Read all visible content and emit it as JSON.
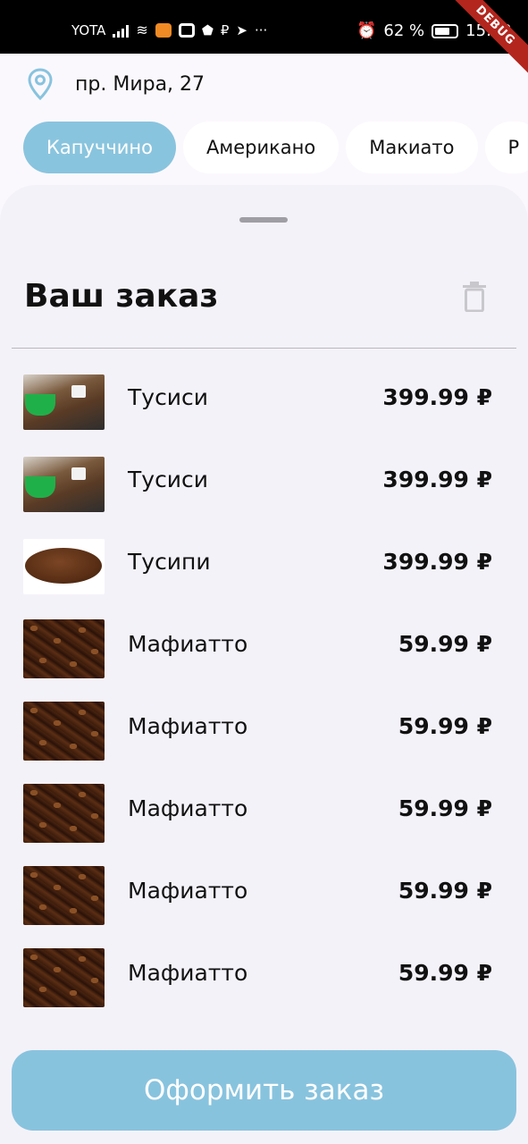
{
  "status_bar": {
    "carrier": "YOTA",
    "battery_percent": "62 %",
    "time": "15:52",
    "debug_banner": "DEBUG"
  },
  "location": {
    "icon": "map-pin-icon",
    "address": "пр. Мира, 27"
  },
  "categories": [
    {
      "label": "Капуччино",
      "active": true
    },
    {
      "label": "Американо",
      "active": false
    },
    {
      "label": "Макиато",
      "active": false
    },
    {
      "label": "Р",
      "active": false
    }
  ],
  "order": {
    "title": "Ваш заказ",
    "clear_icon": "trash-icon",
    "items": [
      {
        "name": "Тусиси",
        "price": "399.99 ₽",
        "image": "cup"
      },
      {
        "name": "Тусиси",
        "price": "399.99 ₽",
        "image": "cup"
      },
      {
        "name": "Тусипи",
        "price": "399.99 ₽",
        "image": "pile"
      },
      {
        "name": "Мафиатто",
        "price": "59.99 ₽",
        "image": "beans"
      },
      {
        "name": "Мафиатто",
        "price": "59.99 ₽",
        "image": "beans"
      },
      {
        "name": "Мафиатто",
        "price": "59.99 ₽",
        "image": "beans"
      },
      {
        "name": "Мафиатто",
        "price": "59.99 ₽",
        "image": "beans"
      },
      {
        "name": "Мафиатто",
        "price": "59.99 ₽",
        "image": "beans"
      }
    ],
    "checkout_label": "Оформить заказ"
  },
  "colors": {
    "accent": "#88c3de",
    "sheet_background": "#f4f2f9",
    "page_background": "#fbf8fd"
  }
}
